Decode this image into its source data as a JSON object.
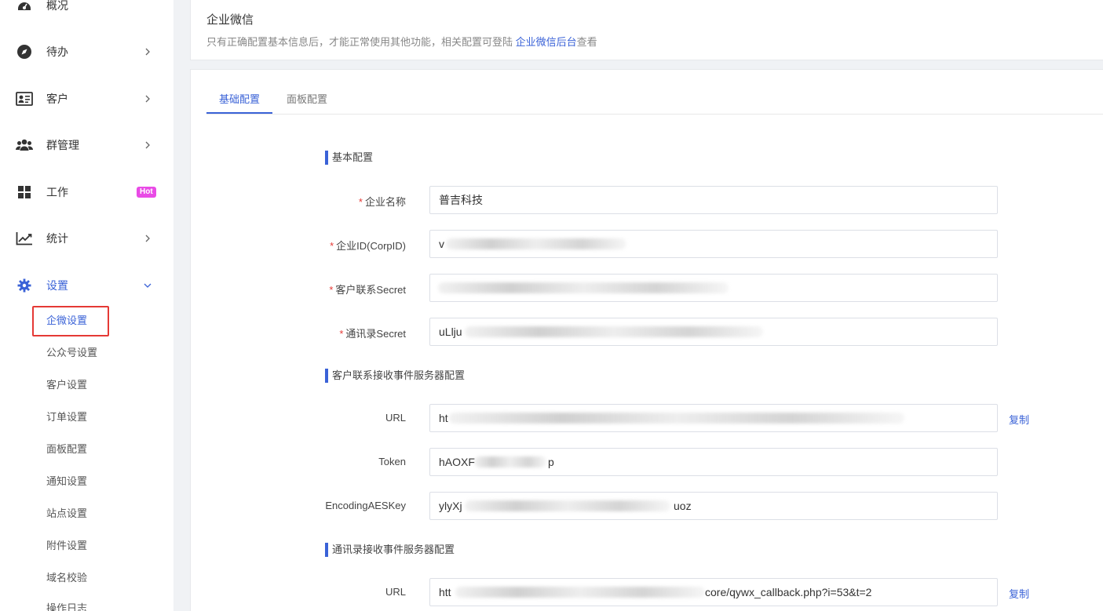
{
  "sidebar": {
    "items": [
      {
        "label": "概况",
        "icon": "dashboard-icon"
      },
      {
        "label": "待办",
        "icon": "compass-icon"
      },
      {
        "label": "客户",
        "icon": "id-card-icon"
      },
      {
        "label": "群管理",
        "icon": "users-icon"
      },
      {
        "label": "工作",
        "icon": "grid-icon",
        "badge": "Hot"
      },
      {
        "label": "统计",
        "icon": "line-chart-icon"
      },
      {
        "label": "设置",
        "icon": "gear-icon"
      }
    ],
    "sub_items": [
      "企微设置",
      "公众号设置",
      "客户设置",
      "订单设置",
      "面板配置",
      "通知设置",
      "站点设置",
      "附件设置",
      "域名校验",
      "操作日志"
    ],
    "active_sub": "企微设置"
  },
  "header": {
    "title": "企业微信",
    "desc_before": "只有正确配置基本信息后，才能正常使用其他功能，相关配置可登陆 ",
    "desc_link": "企业微信后台",
    "desc_after": "查看"
  },
  "tabs": [
    {
      "label": "基础配置",
      "active": true
    },
    {
      "label": "面板配置",
      "active": false
    }
  ],
  "sections": {
    "basic": "基本配置",
    "customer_event": "客户联系接收事件服务器配置",
    "contacts_event": "通讯录接收事件服务器配置"
  },
  "fields": {
    "corp_name": {
      "label": "企业名称",
      "value": "普吉科技"
    },
    "corp_id": {
      "label": "企业ID(CorpID)",
      "value": "v"
    },
    "customer_secret": {
      "label": "客户联系Secret",
      "value": ""
    },
    "contacts_secret": {
      "label": "通讯录Secret",
      "value": "uLlju"
    },
    "customer_url": {
      "label": "URL",
      "value": "ht"
    },
    "token": {
      "label": "Token",
      "value": "hAOXF",
      "value_tail": "p"
    },
    "aes_key": {
      "label": "EncodingAESKey",
      "value": "ylyXj",
      "value_tail": "uoz"
    },
    "contacts_url": {
      "label": "URL",
      "value": "htt",
      "value_tail": "core/qywx_callback.php?i=53&t=2"
    }
  },
  "copy_label": "复制",
  "colors": {
    "accent": "#3a62d7",
    "required": "#e53935",
    "hot": "#e94be6"
  }
}
